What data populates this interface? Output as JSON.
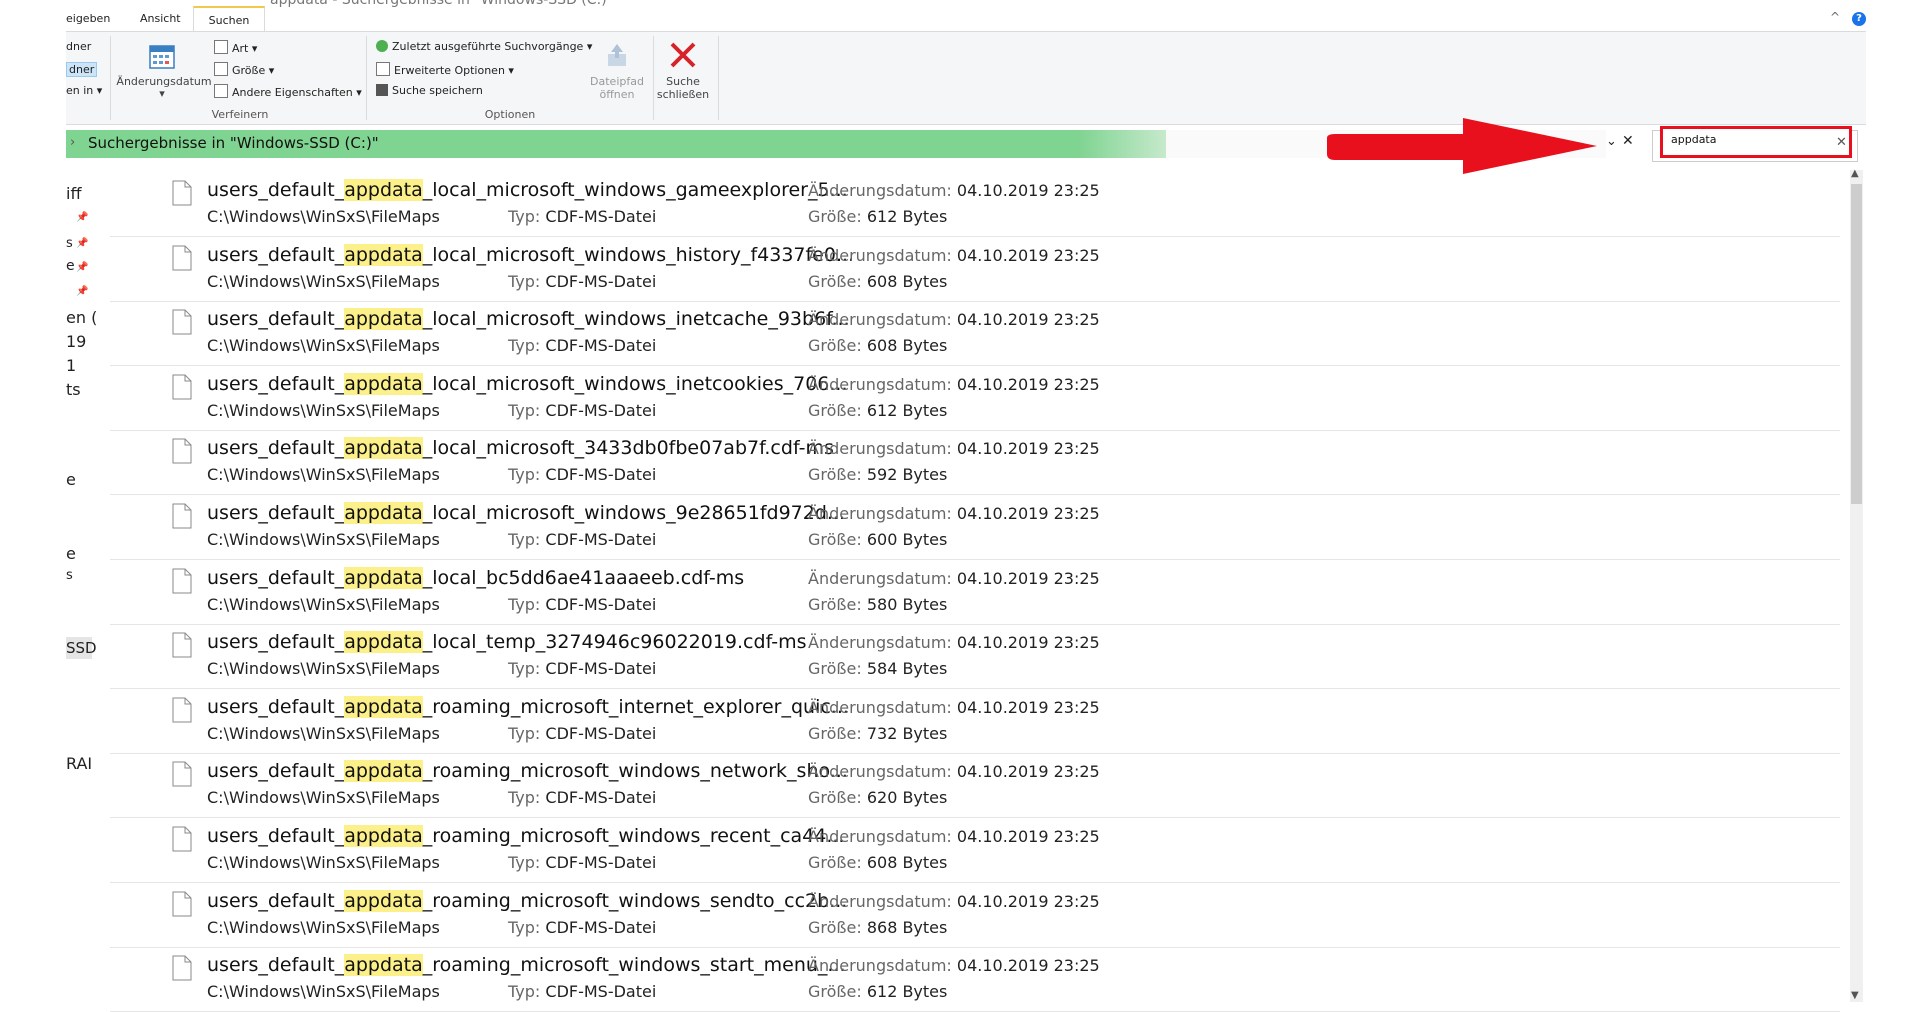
{
  "window": {
    "title": "appdata - Suchergebnisse in \"Windows-SSD (C:)\""
  },
  "tabs": [
    {
      "label": "eigeben"
    },
    {
      "label": "Ansicht"
    },
    {
      "label": "Suchen"
    }
  ],
  "ribbon": {
    "left_fragments": [
      "dner",
      "dner",
      "en in"
    ],
    "aenderungsdatum_label": "Änderungsdatum",
    "art_label": "Art",
    "groesse_label": "Größe",
    "andere_label": "Andere Eigenschaften",
    "verfeinern_label": "Verfeinern",
    "zuletzt_label": "Zuletzt ausgeführte Suchvorgänge",
    "erweitert_label": "Erweiterte Optionen",
    "speichern_label": "Suche speichern",
    "optionen_label": "Optionen",
    "dateipfad_label_1": "Dateipfad",
    "dateipfad_label_2": "öffnen",
    "schliessen_label_1": "Suche",
    "schliessen_label_2": "schließen"
  },
  "address": {
    "location_text": "Suchergebnisse in \"Windows-SSD (C:)\"",
    "dropdown_glyph": "⌄",
    "clear_glyph": "✕"
  },
  "search": {
    "value": "appdata",
    "clear_glyph": "✕"
  },
  "nav_fragments": [
    {
      "text": "iff"
    },
    {
      "text": "s"
    },
    {
      "text": "e"
    },
    {
      "text": "en ("
    },
    {
      "text": "19"
    },
    {
      "text": "1"
    },
    {
      "text": "ts"
    },
    {
      "text": "e"
    },
    {
      "text": "e"
    },
    {
      "text": "s"
    },
    {
      "text": "SSD"
    },
    {
      "text": "RAI"
    }
  ],
  "labels": {
    "date_label": "Änderungsdatum:",
    "size_label": "Größe:",
    "type_label": "Typ:"
  },
  "results": [
    {
      "prefix": "users_default_",
      "highlight": "appdata",
      "suffix": "_local_microsoft_windows_gameexplorer_5...",
      "path": "C:\\Windows\\WinSxS\\FileMaps",
      "type": "CDF-MS-Datei",
      "date": "04.10.2019 23:25",
      "size": "612 Bytes"
    },
    {
      "prefix": "users_default_",
      "highlight": "appdata",
      "suffix": "_local_microsoft_windows_history_f4337fe0...",
      "path": "C:\\Windows\\WinSxS\\FileMaps",
      "type": "CDF-MS-Datei",
      "date": "04.10.2019 23:25",
      "size": "608 Bytes"
    },
    {
      "prefix": "users_default_",
      "highlight": "appdata",
      "suffix": "_local_microsoft_windows_inetcache_93b6f...",
      "path": "C:\\Windows\\WinSxS\\FileMaps",
      "type": "CDF-MS-Datei",
      "date": "04.10.2019 23:25",
      "size": "608 Bytes"
    },
    {
      "prefix": "users_default_",
      "highlight": "appdata",
      "suffix": "_local_microsoft_windows_inetcookies_706...",
      "path": "C:\\Windows\\WinSxS\\FileMaps",
      "type": "CDF-MS-Datei",
      "date": "04.10.2019 23:25",
      "size": "612 Bytes"
    },
    {
      "prefix": "users_default_",
      "highlight": "appdata",
      "suffix": "_local_microsoft_3433db0fbe07ab7f.cdf-ms",
      "path": "C:\\Windows\\WinSxS\\FileMaps",
      "type": "CDF-MS-Datei",
      "date": "04.10.2019 23:25",
      "size": "592 Bytes"
    },
    {
      "prefix": "users_default_",
      "highlight": "appdata",
      "suffix": "_local_microsoft_windows_9e28651fd972d...",
      "path": "C:\\Windows\\WinSxS\\FileMaps",
      "type": "CDF-MS-Datei",
      "date": "04.10.2019 23:25",
      "size": "600 Bytes"
    },
    {
      "prefix": "users_default_",
      "highlight": "appdata",
      "suffix": "_local_bc5dd6ae41aaaeeb.cdf-ms",
      "path": "C:\\Windows\\WinSxS\\FileMaps",
      "type": "CDF-MS-Datei",
      "date": "04.10.2019 23:25",
      "size": "580 Bytes"
    },
    {
      "prefix": "users_default_",
      "highlight": "appdata",
      "suffix": "_local_temp_3274946c96022019.cdf-ms",
      "path": "C:\\Windows\\WinSxS\\FileMaps",
      "type": "CDF-MS-Datei",
      "date": "04.10.2019 23:25",
      "size": "584 Bytes"
    },
    {
      "prefix": "users_default_",
      "highlight": "appdata",
      "suffix": "_roaming_microsoft_internet_explorer_quic...",
      "path": "C:\\Windows\\WinSxS\\FileMaps",
      "type": "CDF-MS-Datei",
      "date": "04.10.2019 23:25",
      "size": "732 Bytes"
    },
    {
      "prefix": "users_default_",
      "highlight": "appdata",
      "suffix": "_roaming_microsoft_windows_network_sho...",
      "path": "C:\\Windows\\WinSxS\\FileMaps",
      "type": "CDF-MS-Datei",
      "date": "04.10.2019 23:25",
      "size": "620 Bytes"
    },
    {
      "prefix": "users_default_",
      "highlight": "appdata",
      "suffix": "_roaming_microsoft_windows_recent_ca44...",
      "path": "C:\\Windows\\WinSxS\\FileMaps",
      "type": "CDF-MS-Datei",
      "date": "04.10.2019 23:25",
      "size": "608 Bytes"
    },
    {
      "prefix": "users_default_",
      "highlight": "appdata",
      "suffix": "_roaming_microsoft_windows_sendto_cc2b...",
      "path": "C:\\Windows\\WinSxS\\FileMaps",
      "type": "CDF-MS-Datei",
      "date": "04.10.2019 23:25",
      "size": "868 Bytes"
    },
    {
      "prefix": "users_default_",
      "highlight": "appdata",
      "suffix": "_roaming_microsoft_windows_start_menu_...",
      "path": "C:\\Windows\\WinSxS\\FileMaps",
      "type": "CDF-MS-Datei",
      "date": "04.10.2019 23:25",
      "size": "612 Bytes"
    }
  ],
  "colors": {
    "search_border": "#e8101d",
    "progress_green": "#7fd491",
    "highlight": "#fbf089",
    "arrow_red": "#e8101d"
  }
}
